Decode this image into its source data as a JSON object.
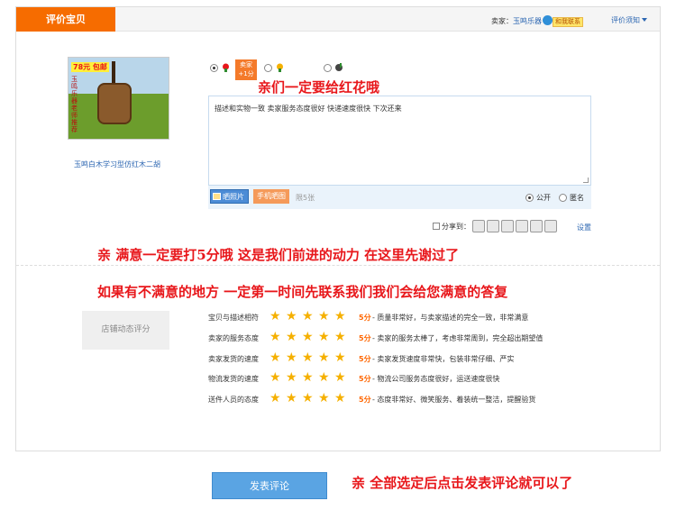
{
  "header": {
    "tab_label": "评价宝贝",
    "seller_prefix": "卖家：",
    "seller_name": "玉鸣乐器",
    "contact_label": "和我联系",
    "rules_link": "评价须知"
  },
  "item": {
    "thumb_badge": "78元 包邮",
    "thumb_side_text": "玉鸣乐器老师推荐",
    "name": "玉鸣白木学习型仿红木二胡"
  },
  "rating": {
    "options": [
      "好评",
      "中评",
      "差评"
    ],
    "selected": "好评",
    "seller_bonus_line1": "卖家",
    "seller_bonus_line2": "+1分"
  },
  "comment": {
    "text": "描述和实物一致  卖家服务态度很好 快递速度很快 下次还来",
    "photo_button": "晒照片",
    "mobile_button": "手机晒图",
    "limit_text": "限5张",
    "visibility_options": [
      "公开",
      "匿名"
    ],
    "visibility_selected": "公开"
  },
  "share": {
    "label": "分享到：",
    "settings_link": "设置"
  },
  "annotations": {
    "red_flower": "亲们一定要给红花哦",
    "five_stars": "亲    满意一定要打5分哦    这是我们前进的动力  在这里先谢过了",
    "contact_first": "如果有不满意的地方  一定第一时间先联系我们我们会给您满意的答复",
    "submit_hint": "亲  全部选定后点击发表评论就可以了"
  },
  "shop_ratings": {
    "title": "店铺动态评分",
    "rows": [
      {
        "label": "宝贝与描述相符",
        "stars": 5,
        "score": "5分",
        "desc": "- 质量非常好，与卖家描述的完全一致，非常满意"
      },
      {
        "label": "卖家的服务态度",
        "stars": 5,
        "score": "5分",
        "desc": "- 卖家的服务太棒了，考虑非常周到，完全超出期望值"
      },
      {
        "label": "卖家发货的速度",
        "stars": 5,
        "score": "5分",
        "desc": "- 卖家发货速度非常快，包装非常仔细、严实"
      },
      {
        "label": "物流发货的速度",
        "stars": 5,
        "score": "5分",
        "desc": "- 物流公司服务态度很好，运送速度很快"
      },
      {
        "label": "送件人员的态度",
        "stars": 5,
        "score": "5分",
        "desc": "- 态度非常好、微笑服务、着装统一整洁，提醒验货"
      }
    ]
  },
  "submit": {
    "label": "发表评论"
  },
  "colors": {
    "tab_orange": "#f66c00",
    "link_blue": "#2d67b2",
    "annotation_red": "#e8171b",
    "star_gold": "#f5b000",
    "submit_blue": "#5aa4e3"
  }
}
